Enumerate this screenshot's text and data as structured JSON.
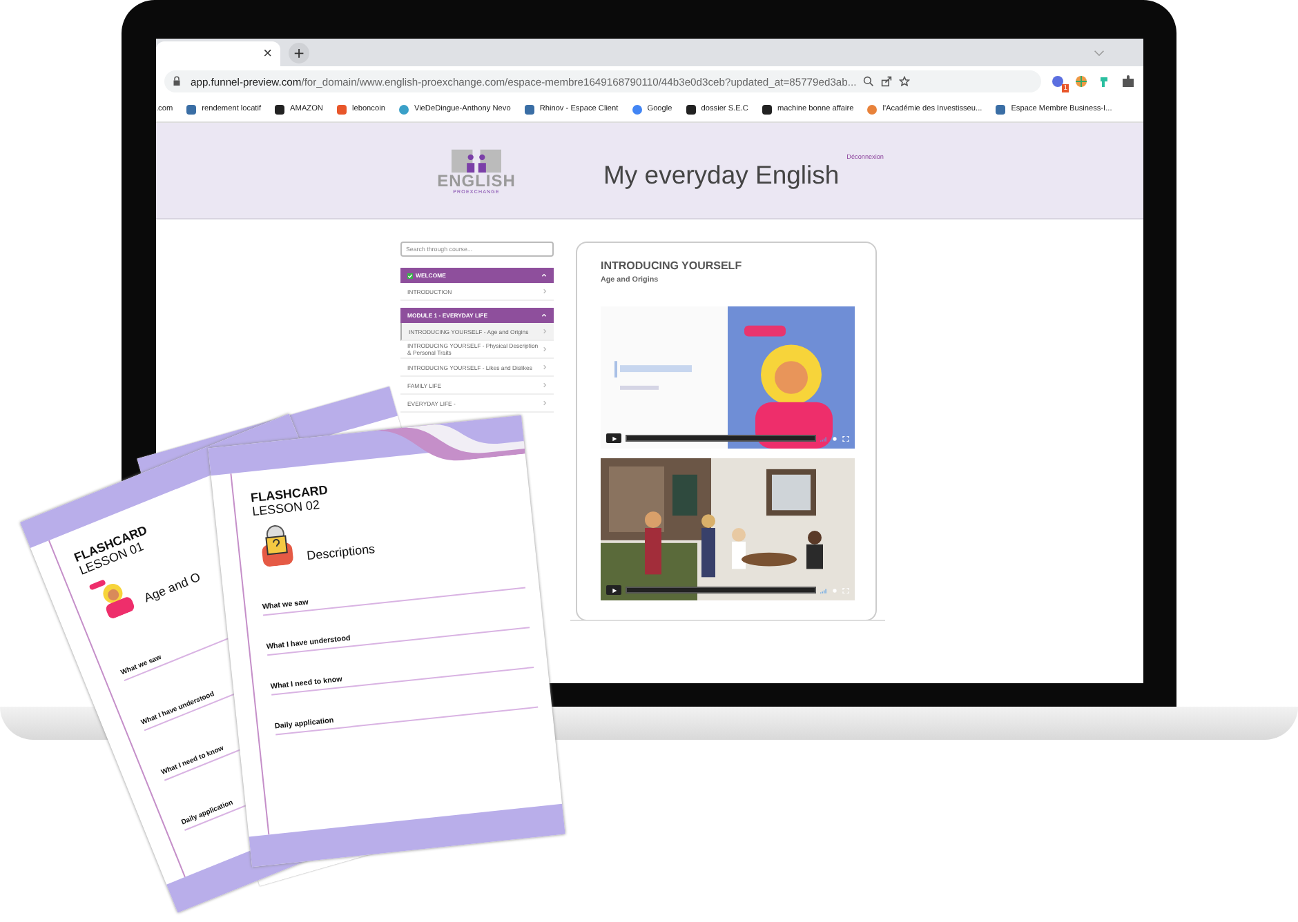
{
  "browser": {
    "tab_close": "×",
    "new_tab": "+",
    "url_host": "app.funnel-preview.com",
    "url_path": "/for_domain/www.english-proexchange.com/espace-membre1649168790110/44b3e0d3ceb?updated_at=85779ed3ab...",
    "extension_badge": "1",
    "bookmarks": [
      ".com",
      "rendement locatif",
      "AMAZON",
      "leboncoin",
      "VieDeDingue-Anthony Nevo",
      "Rhinov - Espace Client",
      "Google",
      "dossier S.E.C",
      "machine bonne affaire",
      "l'Académie des Investisseu...",
      "Espace Membre Business-I..."
    ]
  },
  "site": {
    "logo_text": "ENGLISH",
    "logo_subtext": "PROEXCHANGE",
    "title": "My everyday English",
    "logout_link": "Déconnexion"
  },
  "sidebar": {
    "search": {
      "placeholder": "Search through course..."
    },
    "sections": [
      {
        "title": "WELCOME",
        "completed": true,
        "expanded": true,
        "items": [
          {
            "label": "INTRODUCTION",
            "selected": false
          }
        ]
      },
      {
        "title": "MODULE 1 - EVERYDAY LIFE",
        "completed": false,
        "expanded": true,
        "items": [
          {
            "label": "INTRODUCING YOURSELF - Age and Origins",
            "selected": true
          },
          {
            "label": "INTRODUCING YOURSELF - Physical Description & Personal Traits",
            "selected": false
          },
          {
            "label": "INTRODUCING YOURSELF - Likes and Dislikes",
            "selected": false
          },
          {
            "label": "FAMILY LIFE",
            "selected": false
          },
          {
            "label": "EVERYDAY LIFE -",
            "selected": false
          }
        ]
      }
    ]
  },
  "lesson": {
    "title": "INTRODUCING YOURSELF",
    "subtitle": "Age and Origins",
    "videos": [
      {
        "kind": "title-slide"
      },
      {
        "kind": "cafe-scene"
      }
    ]
  },
  "flashcards": [
    {
      "kind": "waving-woman",
      "heading": "FLASHCARD",
      "lesson": "LESSON 01",
      "topic": "Age and O",
      "prompts": [
        "What we saw",
        "What I have understood",
        "What I need to know",
        "Daily application"
      ]
    },
    {
      "kind": "hidden-face",
      "heading": "FLASHCARD",
      "lesson": "LESSON 02",
      "topic": "Descriptions",
      "prompts": [
        "What we saw",
        "What I have understood",
        "What I need to know",
        "Daily application"
      ]
    }
  ]
}
